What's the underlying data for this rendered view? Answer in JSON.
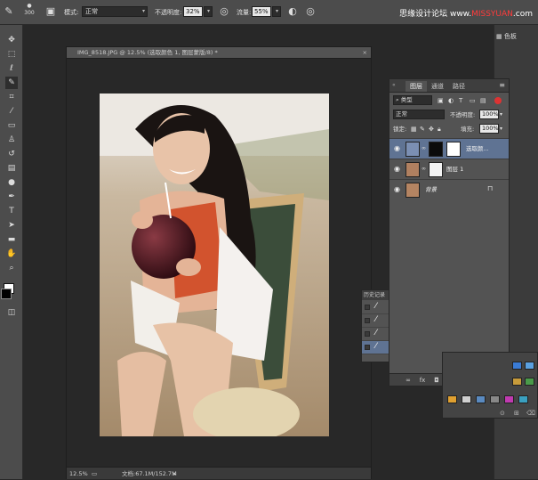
{
  "options_bar": {
    "brush_size": "300",
    "mode_label": "模式:",
    "mode_value": "正常",
    "opacity_label": "不透明度:",
    "opacity_value": "32%",
    "flow_label": "流量:",
    "flow_value": "55%"
  },
  "watermark": {
    "text_cn": "思缘设计论坛",
    "text_url_prefix": "www.",
    "text_url_red": "MISSYUAN",
    "text_url_suffix": ".com"
  },
  "document": {
    "tab_title": "IMG_8518.JPG @ 12.5% (选取颜色 1, 图层蒙版/8) *",
    "close_glyph": "×",
    "zoom": "12.5%",
    "doc_info": "文档:67.1M/152.7M"
  },
  "right_dock": {
    "swatches_label": "色板"
  },
  "layers_panel": {
    "tabs": [
      "图层",
      "通道",
      "路径"
    ],
    "active_tab": "图层",
    "kind_filter": "类型",
    "blend_mode": "正常",
    "opacity_label": "不透明度:",
    "opacity_value": "100%",
    "lock_label": "锁定:",
    "fill_label": "填充:",
    "fill_value": "100%",
    "layers": [
      {
        "name": "选取颜...",
        "selected": true
      },
      {
        "name": "图层 1",
        "selected": false
      },
      {
        "name": "背景",
        "selected": false
      }
    ]
  },
  "history_panel": {
    "title": "历史记录"
  },
  "colors": {
    "ui_bg": "#4c4c4c",
    "panel_bg": "#535353",
    "selection": "#5f7393",
    "canvas_bg": "#282828"
  },
  "icons": {
    "brush": "brush-icon",
    "eye": "eye-icon",
    "lock": "lock-icon"
  }
}
